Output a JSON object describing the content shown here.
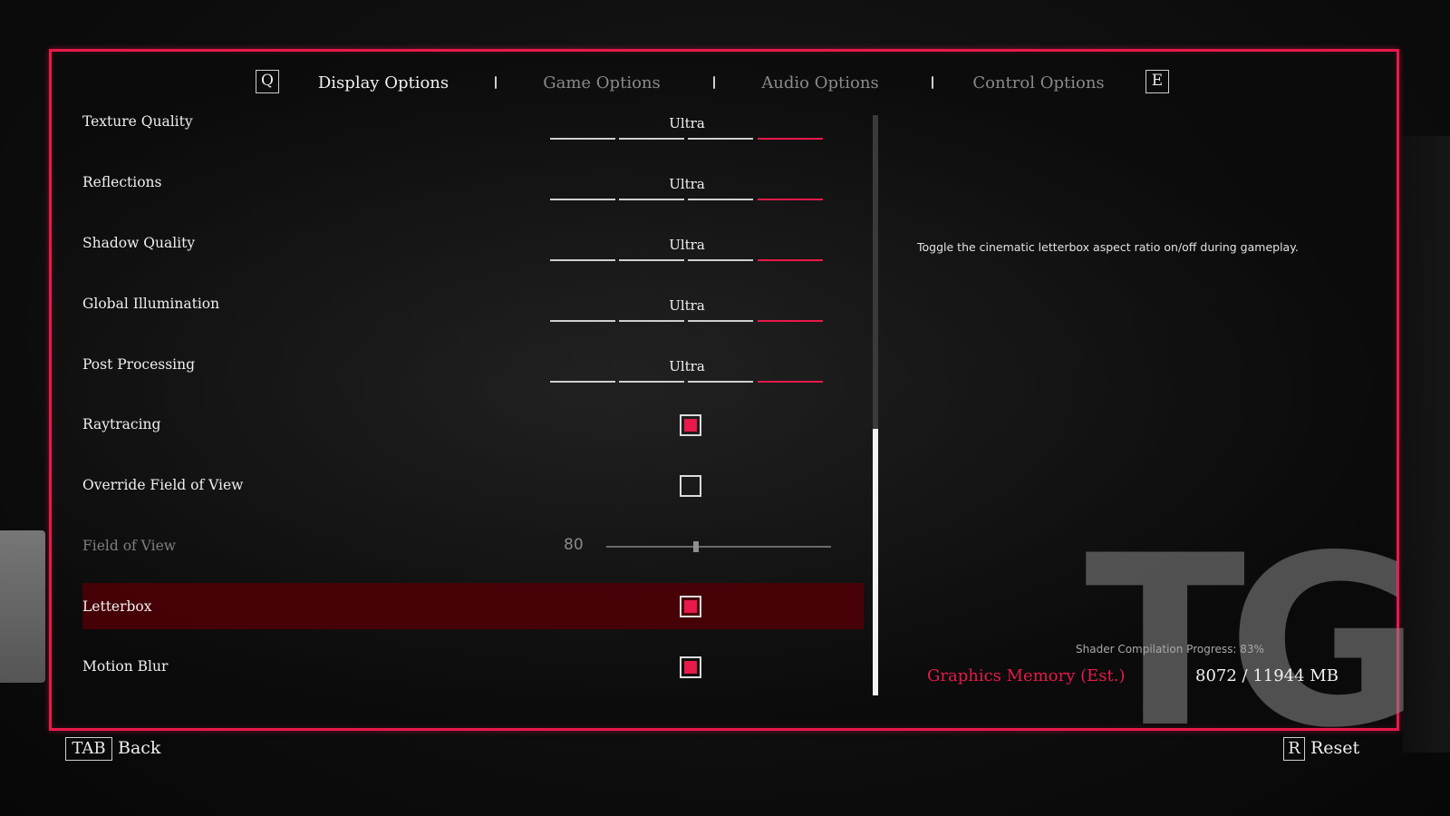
{
  "tabs": {
    "prev_key": "Q",
    "next_key": "E",
    "items": [
      {
        "label": "Display Options",
        "active": true
      },
      {
        "label": "Game Options",
        "active": false
      },
      {
        "label": "Audio Options",
        "active": false
      },
      {
        "label": "Control Options",
        "active": false
      }
    ]
  },
  "settings": [
    {
      "label": "Texture Quality",
      "type": "quality",
      "value": "Ultra",
      "level": 4,
      "levels": 4
    },
    {
      "label": "Reflections",
      "type": "quality",
      "value": "Ultra",
      "level": 4,
      "levels": 4
    },
    {
      "label": "Shadow Quality",
      "type": "quality",
      "value": "Ultra",
      "level": 4,
      "levels": 4
    },
    {
      "label": "Global Illumination",
      "type": "quality",
      "value": "Ultra",
      "level": 4,
      "levels": 4
    },
    {
      "label": "Post Processing",
      "type": "quality",
      "value": "Ultra",
      "level": 4,
      "levels": 4
    },
    {
      "label": "Raytracing",
      "type": "checkbox",
      "checked": true
    },
    {
      "label": "Override Field of View",
      "type": "checkbox",
      "checked": false
    },
    {
      "label": "Field of View",
      "type": "slider",
      "value": "80",
      "fraction": 0.4,
      "disabled": true
    },
    {
      "label": "Letterbox",
      "type": "checkbox",
      "checked": true,
      "selected": true
    },
    {
      "label": "Motion Blur",
      "type": "checkbox",
      "checked": true
    }
  ],
  "scrollbar": {
    "thumb_start_fraction": 0.54,
    "thumb_end_fraction": 1.0
  },
  "description": "Toggle the cinematic letterbox aspect ratio on/off during gameplay.",
  "shader_progress": {
    "label": "Shader Compilation Progress:",
    "value": "83%"
  },
  "graphics_memory": {
    "label": "Graphics Memory (Est.)",
    "value": "8072 / 11944 MB"
  },
  "watermark": "TG",
  "footer": {
    "back_key": "TAB",
    "back_label": "Back",
    "reset_key": "R",
    "reset_label": "Reset"
  },
  "colors": {
    "accent": "#e8194b",
    "selected_row": "#500006"
  }
}
